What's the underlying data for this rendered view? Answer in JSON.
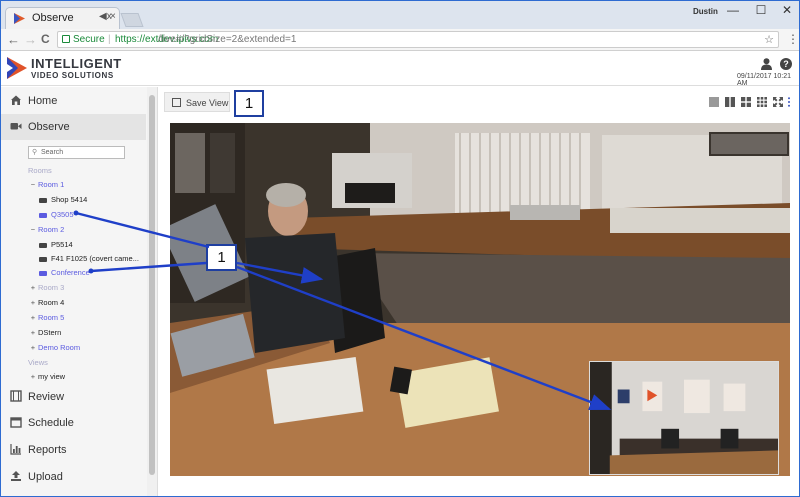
{
  "browser": {
    "tab_title": "Observe",
    "tab_audio": "◀x",
    "tab_close": "×",
    "profile": "Dustin",
    "back": "←",
    "forward": "→",
    "reload": "C",
    "secure_label": "Secure",
    "url_host": "https://extdev.ipivs.com",
    "url_path": "/live#/?gridSize=2&extended=1",
    "star": "☆",
    "menu": "⋮",
    "minimize": "—",
    "maximize": "☐",
    "close": "✕"
  },
  "header": {
    "logo_line1": "INTELLIGENT",
    "logo_line2": "VIDEO SOLUTIONS",
    "datetime": "09/11/2017 10:21 AM"
  },
  "sidebar": {
    "nav": [
      {
        "label": "Home",
        "icon": "home-icon"
      },
      {
        "label": "Observe",
        "icon": "video-camera-icon"
      },
      {
        "label": "Review",
        "icon": "film-icon"
      },
      {
        "label": "Schedule",
        "icon": "calendar-icon"
      },
      {
        "label": "Reports",
        "icon": "bar-chart-icon"
      },
      {
        "label": "Upload",
        "icon": "upload-icon"
      }
    ],
    "search_placeholder": "Search",
    "rooms_header": "Rooms",
    "tree": [
      {
        "marker": "−",
        "label": "Room 1"
      },
      {
        "label": "Shop 5414"
      },
      {
        "label": "Q3505"
      },
      {
        "marker": "−",
        "label": "Room 2"
      },
      {
        "label": "P5514"
      },
      {
        "label": "F41 F1025 (covert came..."
      },
      {
        "label": "Conference"
      },
      {
        "marker": "+",
        "label": "Room 3"
      },
      {
        "marker": "+",
        "label": "Room 4"
      },
      {
        "marker": "+",
        "label": "Room 5"
      },
      {
        "marker": "+",
        "label": "DStern"
      },
      {
        "marker": "+",
        "label": "Demo Room"
      }
    ],
    "views_header": "Views",
    "views": [
      {
        "marker": "+",
        "label": "my view"
      }
    ]
  },
  "toolbar": {
    "save_view_label": "Save View",
    "callout_label": "1"
  },
  "annotation": {
    "callout_label": "1",
    "arrow_color": "#1f3fc8"
  },
  "colors": {
    "link": "#5b5be0",
    "callout_border": "#1f3fa0"
  }
}
